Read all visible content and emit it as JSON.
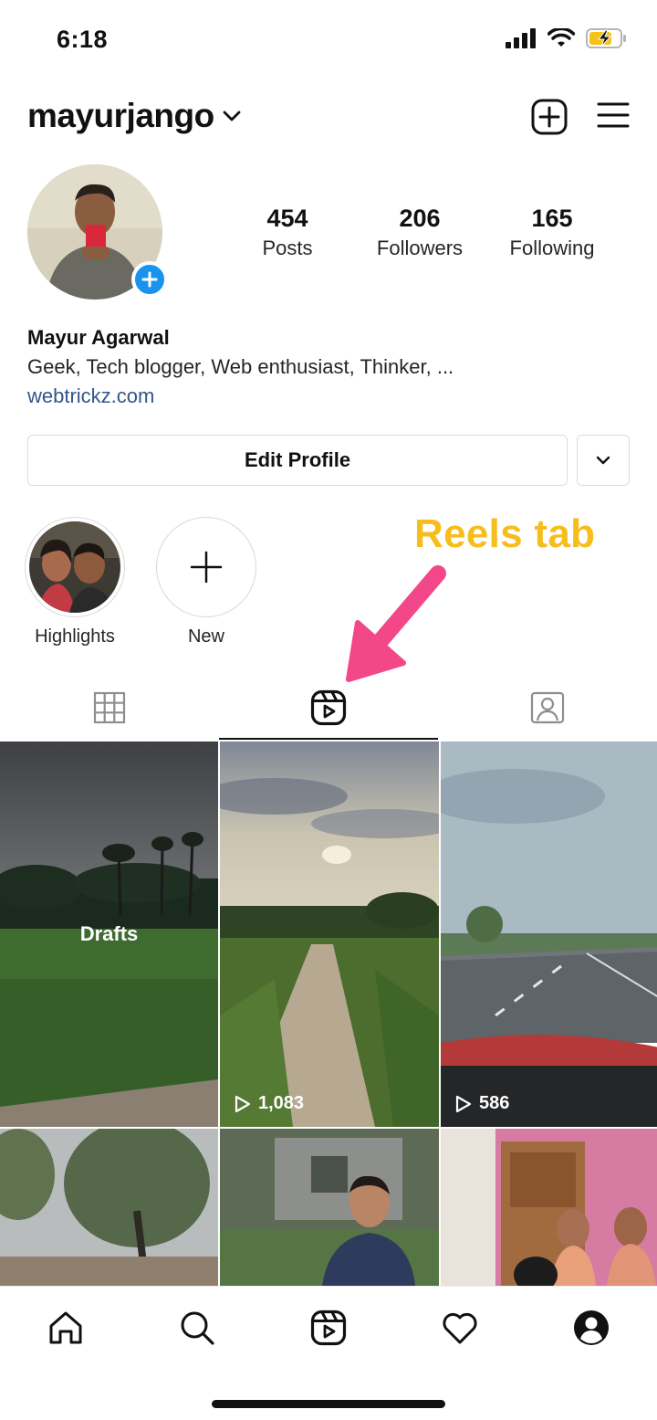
{
  "status_bar": {
    "time": "6:18",
    "icons": [
      "signal-icon",
      "wifi-icon",
      "battery-charging-icon"
    ]
  },
  "header": {
    "username": "mayurjango",
    "icons": [
      "chevron-down-icon",
      "new-post-icon",
      "menu-icon"
    ]
  },
  "profile": {
    "stats": [
      {
        "value": "454",
        "label": "Posts"
      },
      {
        "value": "206",
        "label": "Followers"
      },
      {
        "value": "165",
        "label": "Following"
      }
    ],
    "name": "Mayur Agarwal",
    "bio": "Geek, Tech blogger, Web enthusiast, Thinker, ...",
    "link": "webtrickz.com",
    "edit_label": "Edit Profile"
  },
  "highlights": [
    {
      "label": "Highlights"
    },
    {
      "label": "New"
    }
  ],
  "annotation": {
    "label": "Reels tab",
    "color": "#f6be1c",
    "arrow_color": "#f2488a"
  },
  "tabs": [
    {
      "icon": "grid-icon",
      "active": false
    },
    {
      "icon": "reels-icon",
      "active": true
    },
    {
      "icon": "tagged-icon",
      "active": false
    }
  ],
  "reels": [
    {
      "label": "Drafts"
    },
    {
      "views": "1,083"
    },
    {
      "views": "586"
    }
  ],
  "bottom_nav": [
    "home-icon",
    "search-icon",
    "reels-icon",
    "heart-icon",
    "profile-icon"
  ],
  "colors": {
    "link": "#32568a",
    "badge": "#1a93ee"
  }
}
